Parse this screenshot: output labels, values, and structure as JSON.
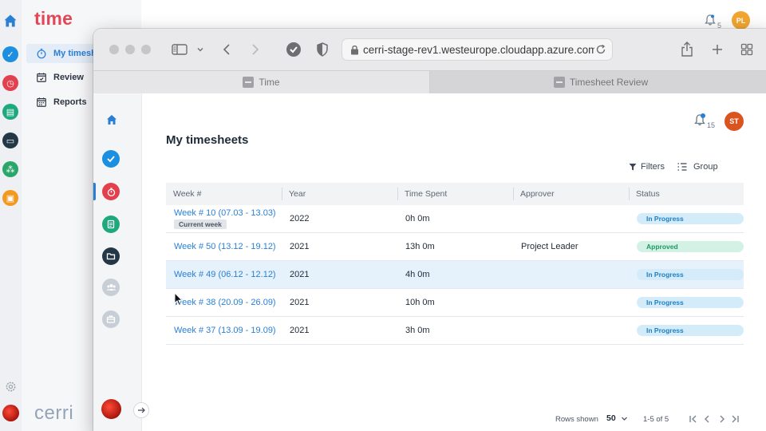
{
  "background_app": {
    "logo": "time",
    "nav_items": [
      {
        "label": "My timeshe",
        "icon": "stopwatch-icon",
        "active": true
      },
      {
        "label": "Review",
        "icon": "calendar-check-icon",
        "active": false
      },
      {
        "label": "Reports",
        "icon": "calendar-grid-icon",
        "active": false
      }
    ],
    "brand": "cerri",
    "notification_count": "5",
    "avatar_initials": "PL",
    "colors": {
      "logo": "#e34756",
      "accent": "#2a7fd5",
      "avatar": "#f2a630"
    }
  },
  "browser": {
    "url": "cerri-stage-rev1.westeurope.cloudapp.azure.com",
    "tabs": [
      {
        "label": "Time",
        "active": false
      },
      {
        "label": "Timesheet Review",
        "active": true
      }
    ]
  },
  "app": {
    "page_title": "My timesheets",
    "notification_count": "15",
    "avatar_initials": "ST",
    "toolbar": {
      "filters_label": "Filters",
      "group_label": "Group"
    },
    "table": {
      "columns": [
        "Week #",
        "Year",
        "Time Spent",
        "Approver",
        "Status"
      ],
      "rows": [
        {
          "week": "Week # 10 (07.03 - 13.03)",
          "tag": "Current week",
          "year": "2022",
          "time_spent": "0h 0m",
          "approver": "",
          "status": "In Progress",
          "status_type": "progress"
        },
        {
          "week": "Week # 50 (13.12 - 19.12)",
          "tag": "",
          "year": "2021",
          "time_spent": "13h 0m",
          "approver": "Project Leader",
          "status": "Approved",
          "status_type": "approved"
        },
        {
          "week": "Week # 49 (06.12 - 12.12)",
          "tag": "",
          "year": "2021",
          "time_spent": "4h 0m",
          "approver": "",
          "status": "In Progress",
          "status_type": "progress",
          "highlighted": true
        },
        {
          "week": "Week # 38 (20.09 - 26.09)",
          "tag": "",
          "year": "2021",
          "time_spent": "10h 0m",
          "approver": "",
          "status": "In Progress",
          "status_type": "progress"
        },
        {
          "week": "Week # 37 (13.09 - 19.09)",
          "tag": "",
          "year": "2021",
          "time_spent": "3h 0m",
          "approver": "",
          "status": "In Progress",
          "status_type": "progress"
        }
      ]
    },
    "pagination": {
      "rows_shown_label": "Rows shown",
      "rows_shown_value": "50",
      "range": "1-5 of 5"
    },
    "colors": {
      "accent": "#2a7fd5",
      "in_progress_bg": "#d4ecfa",
      "approved_bg": "#d3f1e4",
      "row_highlight": "#e5f1fb"
    }
  }
}
